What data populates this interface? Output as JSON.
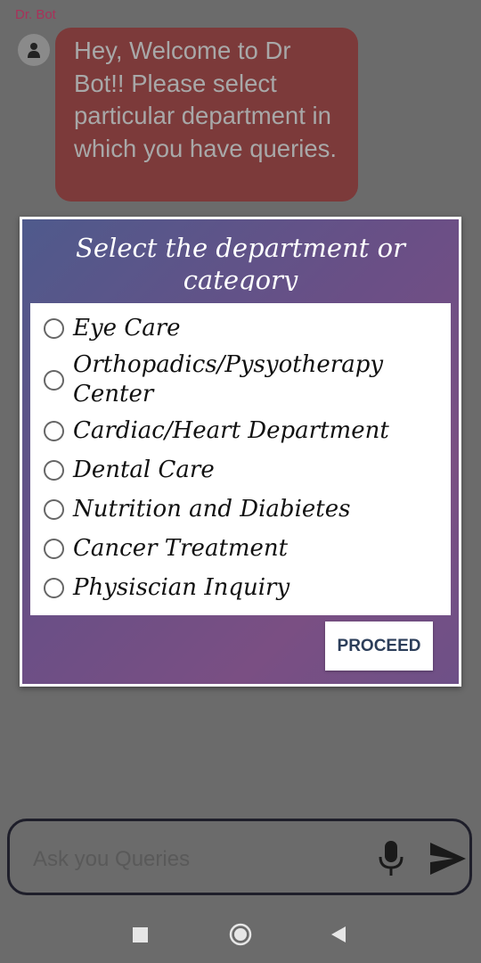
{
  "chat": {
    "bot_name": "Dr. Bot",
    "message": "Hey, Welcome to Dr Bot!! Please select particular department in which you have queries."
  },
  "dialog": {
    "title": "Select the department or category",
    "options": [
      {
        "label": "Eye Care",
        "selected": false
      },
      {
        "label": "Orthopadics/Pysyotherapy Center",
        "selected": false
      },
      {
        "label": "Cardiac/Heart Department",
        "selected": false
      },
      {
        "label": "Dental Care",
        "selected": false
      },
      {
        "label": "Nutrition and Diabietes",
        "selected": false
      },
      {
        "label": "Cancer Treatment",
        "selected": false
      },
      {
        "label": "Physiscian Inquiry",
        "selected": false
      }
    ],
    "proceed_label": "PROCEED"
  },
  "input": {
    "placeholder": "Ask you Queries",
    "mic_icon": "microphone-icon",
    "send_icon": "send-icon"
  },
  "navigation": {
    "icons": [
      "recents-square-icon",
      "home-circle-icon",
      "back-triangle-icon"
    ]
  },
  "colors": {
    "background_overlay": "#6b6b6b",
    "bot_name": "#a8325a",
    "bubble": "#7c3a3a",
    "dialog_gradient_start": "#4f5a8c",
    "dialog_gradient_end": "#7a4f83",
    "proceed_text": "#2c3e5a"
  }
}
